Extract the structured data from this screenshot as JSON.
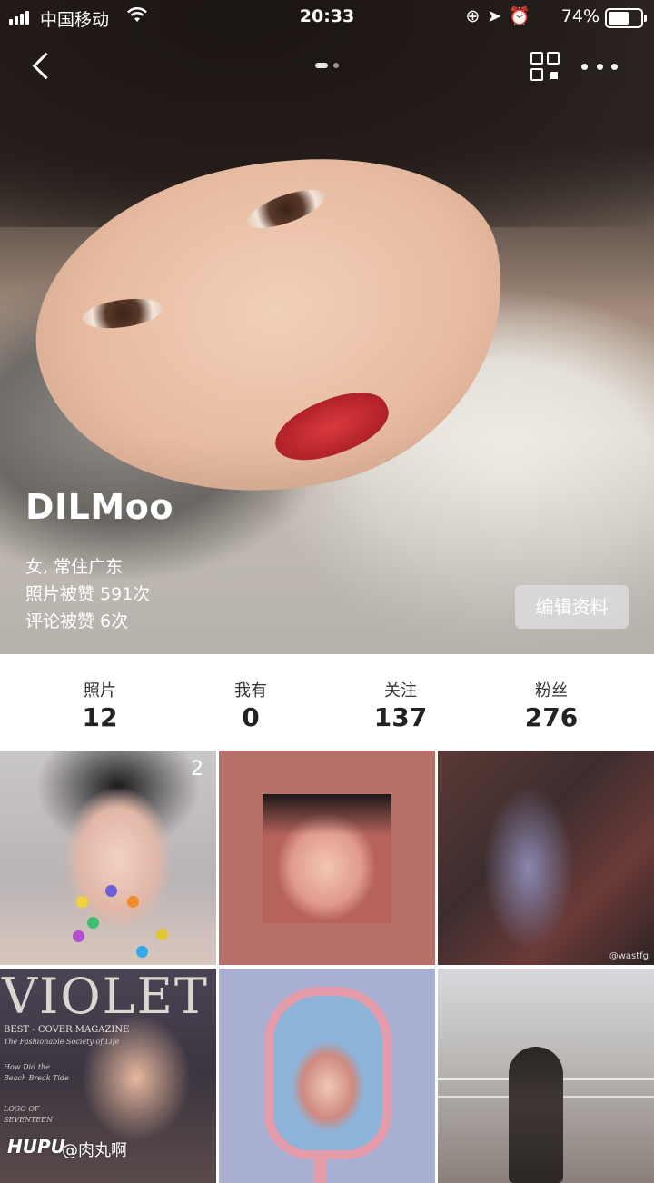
{
  "status_bar": {
    "carrier": "中国移动",
    "time": "20:33",
    "battery_percent": "74%",
    "battery_level": 0.74,
    "icons": [
      "signal-icon",
      "wifi-icon",
      "orientation-lock-icon",
      "location-icon",
      "alarm-icon",
      "battery-icon"
    ]
  },
  "nav": {
    "back_icon": "back-chevron-icon",
    "pager_dots": 2,
    "active_page": 1,
    "qr_icon": "qr-code-icon",
    "more_icon": "more-dots-icon"
  },
  "profile": {
    "name": "DILMoo",
    "gender_location": "女, 常住广东",
    "photo_likes": "照片被赞 591次",
    "comment_likes": "评论被赞 6次",
    "edit_button": "编辑资料"
  },
  "stats": [
    {
      "label": "照片",
      "value": "12"
    },
    {
      "label": "我有",
      "value": "0"
    },
    {
      "label": "关注",
      "value": "137"
    },
    {
      "label": "粉丝",
      "value": "276"
    }
  ],
  "grid": {
    "tile1_count": "2",
    "tile3_watermark": "@wastfg",
    "tile4_magazine": "VIOLET",
    "tile4_subtitle": "BEST - COVER MAGAZINE",
    "tile4_line1": "The Fashionable Society of Life",
    "tile4_line2": "How Did the",
    "tile4_line3": "Beach Break Tide",
    "tile4_line4": "LOGO OF",
    "tile4_line5": "SEVENTEEN"
  },
  "watermark": {
    "brand": "HUPU",
    "user": "@肉丸啊"
  },
  "colors": {
    "smiley_colors": [
      "#f4d23a",
      "#6a5fd6",
      "#3bbf6a",
      "#f08a2c",
      "#e2c631",
      "#b14fd1",
      "#35a8e8"
    ]
  }
}
